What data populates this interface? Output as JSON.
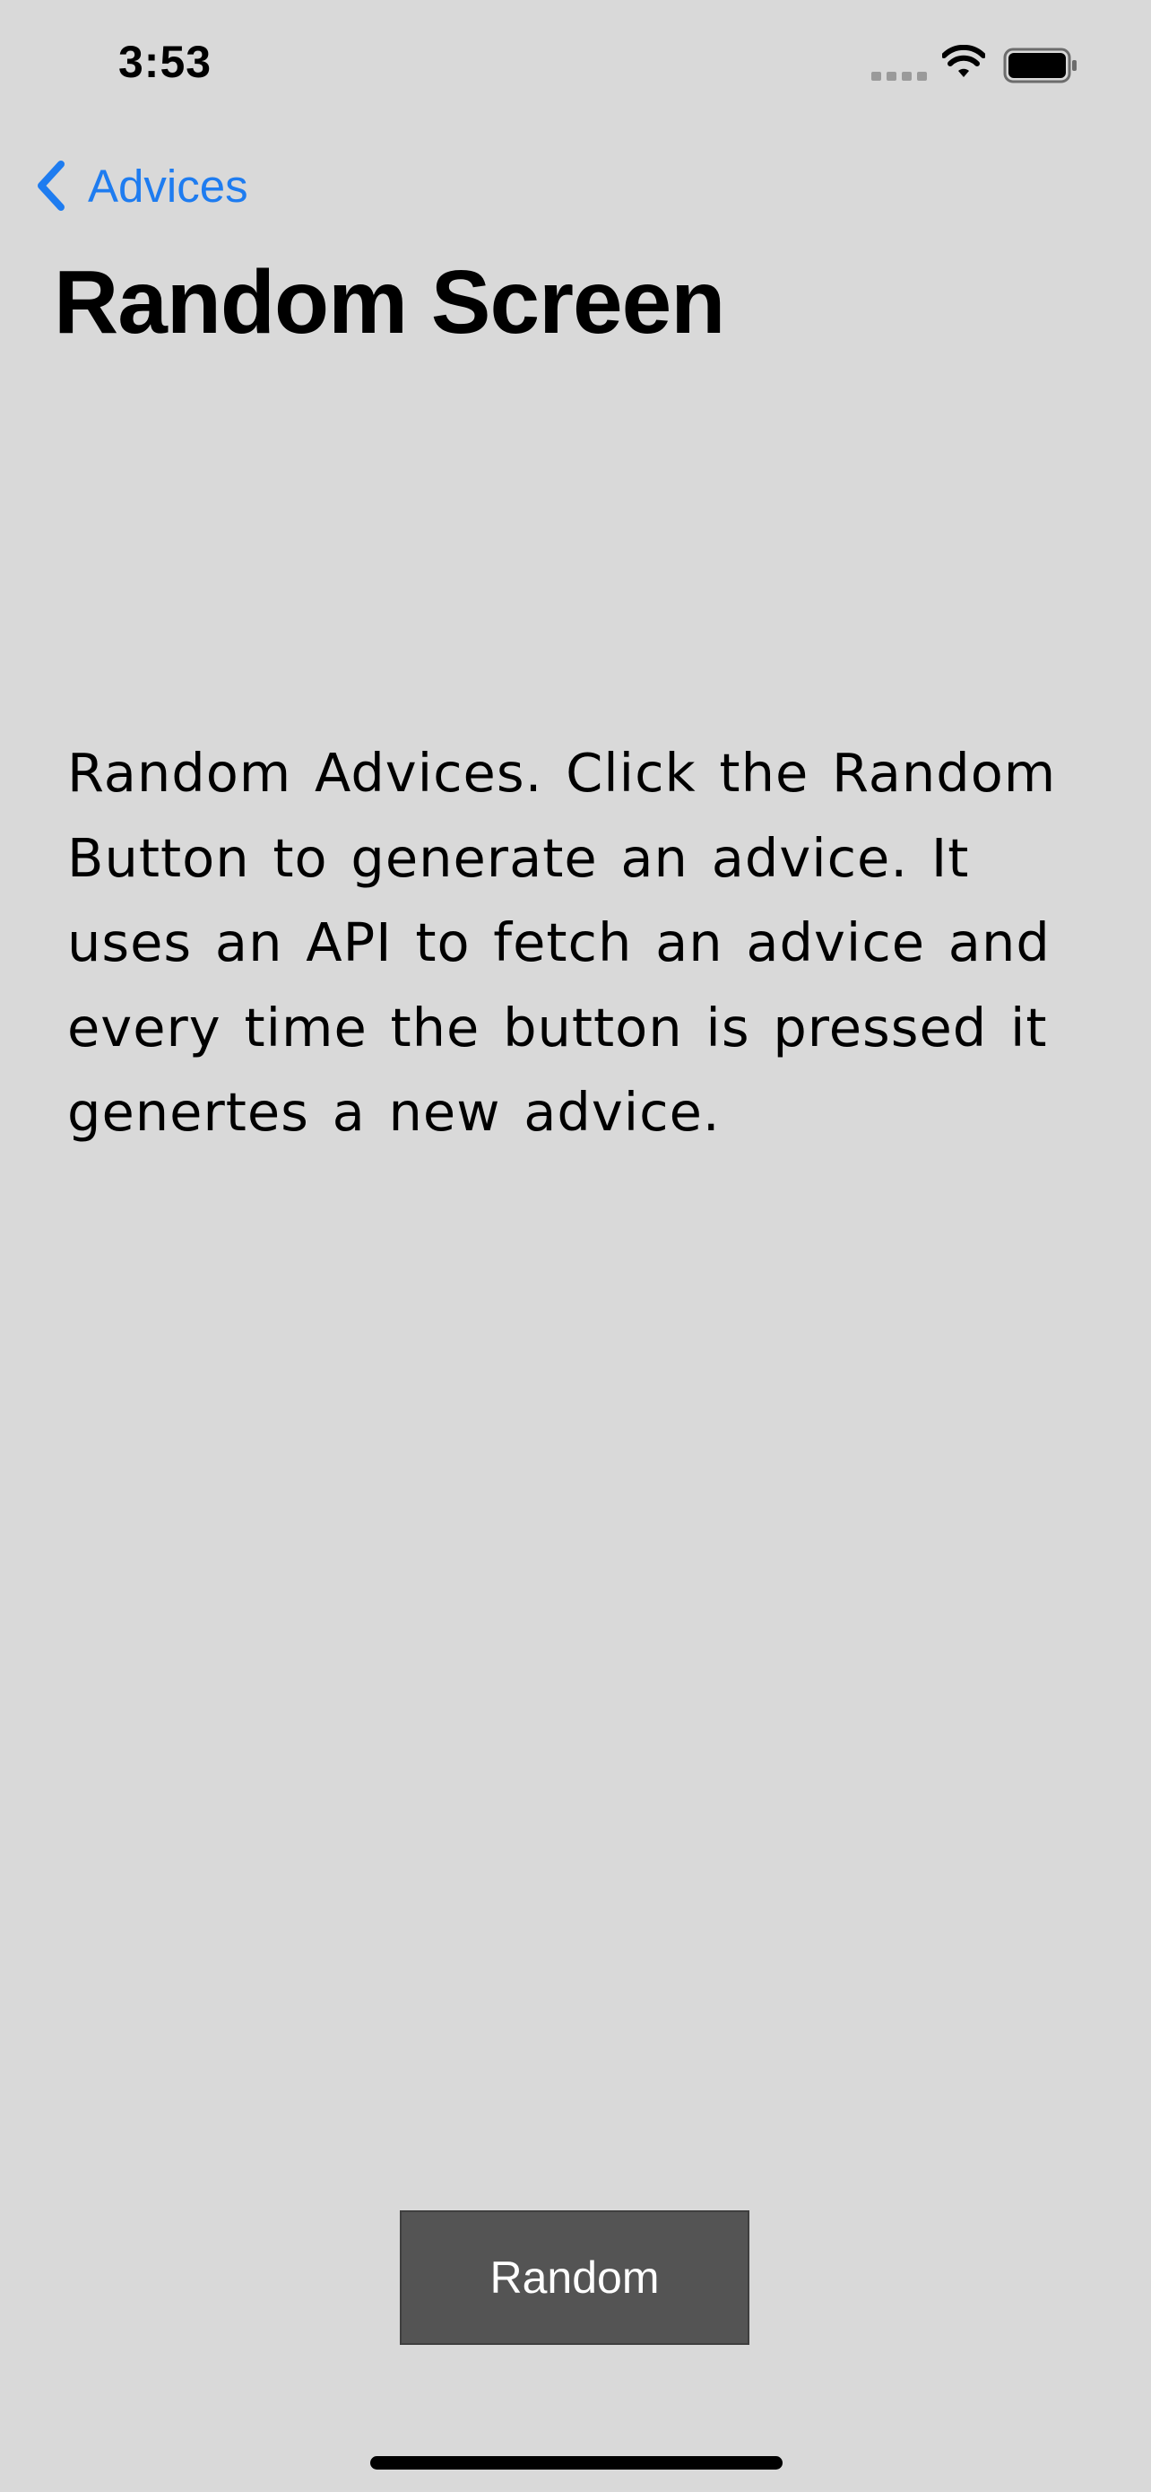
{
  "status_bar": {
    "time": "3:53"
  },
  "nav": {
    "back_label": "Advices"
  },
  "page": {
    "title": "Random Screen",
    "description": "Random Advices. Click the Random Button to generate an  advice. It uses an API to fetch an advice and every time the button is pressed it genertes a new advice."
  },
  "actions": {
    "random_label": "Random"
  },
  "colors": {
    "background": "#d9d9d9",
    "accent": "#1e7cf0",
    "button": "#545454",
    "button_text": "#ffffff"
  },
  "icons": {
    "back": "chevron-left-icon",
    "signal": "cellular-signal-icon",
    "wifi": "wifi-icon",
    "battery": "battery-icon"
  }
}
